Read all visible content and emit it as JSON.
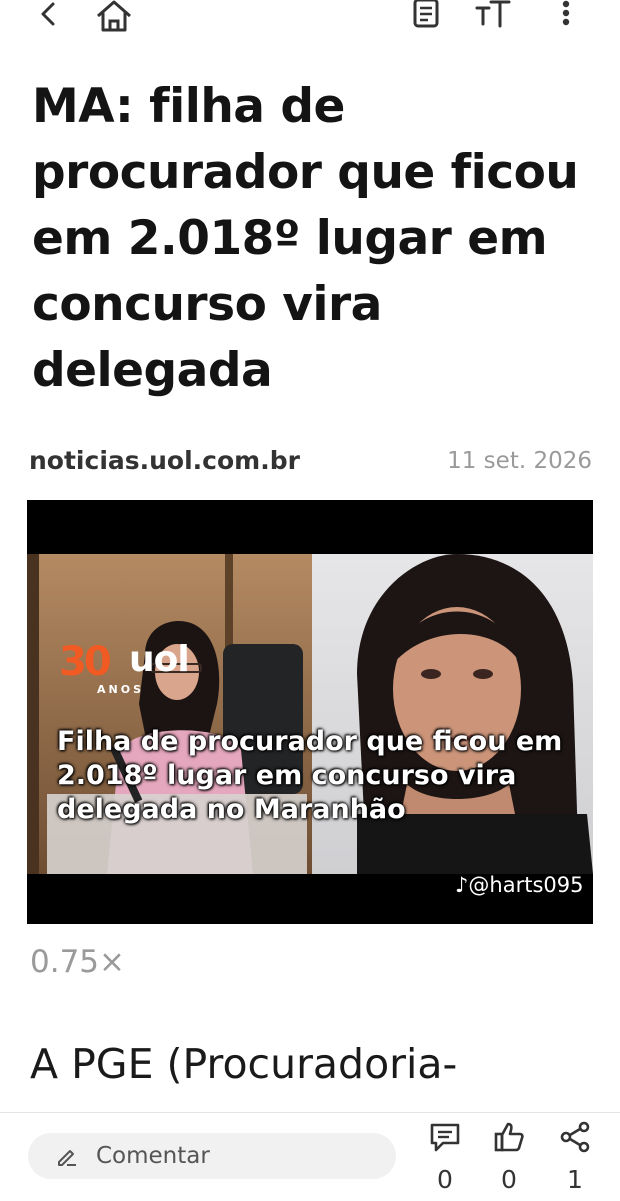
{
  "article": {
    "headline": "MA: filha de procurador que ficou em 2.018º lugar em concurso vira delegada",
    "source": "noticias.uol.com.br",
    "date": "11 set. 2026",
    "body_start": "A PGE (Procuradoria-"
  },
  "video": {
    "logo_number": "30",
    "logo_word": "uol",
    "logo_sub": "ANOS",
    "caption": "Filha de procurador que ficou em 2.018º lugar em concurso vira delegada no Maranhão",
    "watermark": "@harts095",
    "speed": "0.75×"
  },
  "bottom_bar": {
    "comment_label": "Comentar",
    "comments_count": "0",
    "likes_count": "0",
    "shares_count": "1"
  },
  "icons": {
    "top_bar": [
      "back-icon",
      "home-icon",
      "reader-icon",
      "text-size-icon",
      "more-icon"
    ],
    "bottom_bar": [
      "pencil-icon",
      "comment-icon",
      "thumbs-up-icon",
      "share-icon"
    ],
    "watermark": "tiktok-icon"
  },
  "colors": {
    "text": "#141414",
    "muted": "#9a9a9a",
    "uol_orange": "#f15a22",
    "video_bg": "#000000"
  }
}
